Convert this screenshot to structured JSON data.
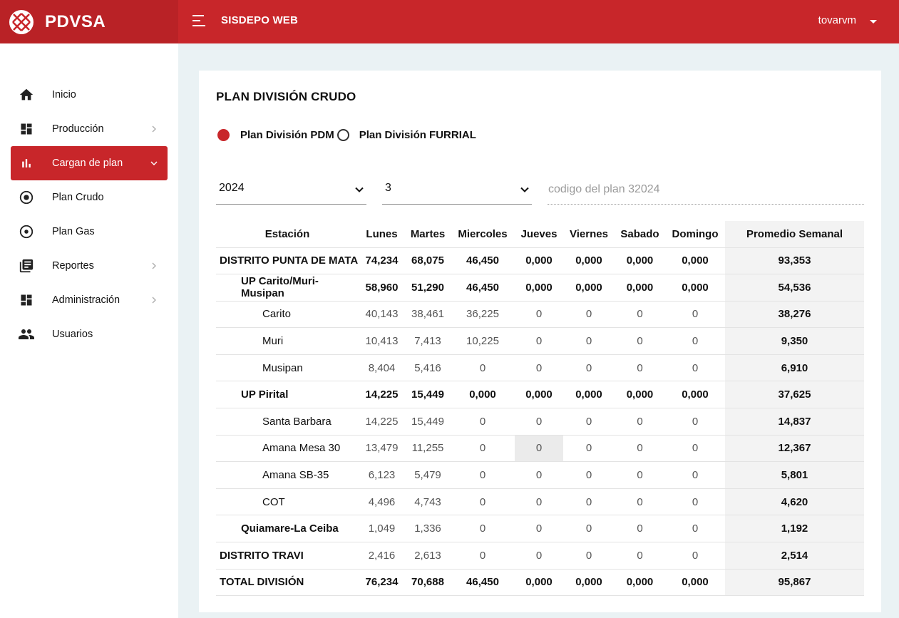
{
  "brand": {
    "name": "PDVSA"
  },
  "header": {
    "app_title": "SISDEPO WEB",
    "user": "tovarvm"
  },
  "sidebar": {
    "items": [
      {
        "label": "Inicio",
        "icon": "home-icon",
        "submenu": false,
        "active": false
      },
      {
        "label": "Producción",
        "icon": "dashboard-icon",
        "submenu": true,
        "active": false
      },
      {
        "label": "Cargan de plan",
        "icon": "bar-chart-icon",
        "submenu": true,
        "active": true
      },
      {
        "label": "Plan Crudo",
        "icon": "radio-target-icon",
        "submenu": false,
        "active": false
      },
      {
        "label": "Plan Gas",
        "icon": "radio-target-icon",
        "submenu": false,
        "active": false
      },
      {
        "label": "Reportes",
        "icon": "library-books-icon",
        "submenu": true,
        "active": false
      },
      {
        "label": "Administración",
        "icon": "dashboard-icon",
        "submenu": true,
        "active": false
      },
      {
        "label": "Usuarios",
        "icon": "people-icon",
        "submenu": false,
        "active": false
      }
    ]
  },
  "main": {
    "title": "PLAN DIVISIÓN CRUDO",
    "radio_pdm": "Plan División PDM",
    "radio_furrial": "Plan División FURRIAL",
    "selected_radio": "pdm",
    "year": "2024",
    "week": "3",
    "code_placeholder": "codigo del plan 32024",
    "columns": [
      "Estación",
      "Lunes",
      "Martes",
      "Miercoles",
      "Jueves",
      "Viernes",
      "Sabado",
      "Domingo",
      "Promedio Semanal"
    ],
    "rows": [
      {
        "name": "DISTRITO PUNTA DE MATA",
        "level": 0,
        "bold": true,
        "values": [
          "74,234",
          "68,075",
          "46,450",
          "0,000",
          "0,000",
          "0,000",
          "0,000"
        ],
        "avg": "93,353"
      },
      {
        "name": "UP Carito/Muri-Musipan",
        "level": 1,
        "bold": true,
        "values": [
          "58,960",
          "51,290",
          "46,450",
          "0,000",
          "0,000",
          "0,000",
          "0,000"
        ],
        "avg": "54,536"
      },
      {
        "name": "Carito",
        "level": 2,
        "bold": false,
        "values": [
          "40,143",
          "38,461",
          "36,225",
          "0",
          "0",
          "0",
          "0"
        ],
        "avg": "38,276"
      },
      {
        "name": "Muri",
        "level": 2,
        "bold": false,
        "values": [
          "10,413",
          "7,413",
          "10,225",
          "0",
          "0",
          "0",
          "0"
        ],
        "avg": "9,350"
      },
      {
        "name": "Musipan",
        "level": 2,
        "bold": false,
        "values": [
          "8,404",
          "5,416",
          "0",
          "0",
          "0",
          "0",
          "0"
        ],
        "avg": "6,910"
      },
      {
        "name": "UP Pirital",
        "level": 1,
        "bold": true,
        "values": [
          "14,225",
          "15,449",
          "0,000",
          "0,000",
          "0,000",
          "0,000",
          "0,000"
        ],
        "avg": "37,625"
      },
      {
        "name": "Santa Barbara",
        "level": 2,
        "bold": false,
        "values": [
          "14,225",
          "15,449",
          "0",
          "0",
          "0",
          "0",
          "0"
        ],
        "avg": "14,837"
      },
      {
        "name": "Amana Mesa 30",
        "level": 2,
        "bold": false,
        "values": [
          "13,479",
          "11,255",
          "0",
          "0",
          "0",
          "0",
          "0"
        ],
        "avg": "12,367",
        "highlight_col": 3
      },
      {
        "name": "Amana SB-35",
        "level": 2,
        "bold": false,
        "values": [
          "6,123",
          "5,479",
          "0",
          "0",
          "0",
          "0",
          "0"
        ],
        "avg": "5,801"
      },
      {
        "name": "COT",
        "level": 2,
        "bold": false,
        "values": [
          "4,496",
          "4,743",
          "0",
          "0",
          "0",
          "0",
          "0"
        ],
        "avg": "4,620"
      },
      {
        "name": "Quiamare-La Ceiba",
        "level": 1,
        "bold": false,
        "name_bold": true,
        "values": [
          "1,049",
          "1,336",
          "0",
          "0",
          "0",
          "0",
          "0"
        ],
        "avg": "1,192"
      },
      {
        "name": "DISTRITO TRAVI",
        "level": 0,
        "bold": false,
        "name_bold": true,
        "values": [
          "2,416",
          "2,613",
          "0",
          "0",
          "0",
          "0",
          "0"
        ],
        "avg": "2,514"
      },
      {
        "name": "TOTAL DIVISIÓN",
        "level": 0,
        "bold": true,
        "values": [
          "76,234",
          "70,688",
          "46,450",
          "0,000",
          "0,000",
          "0,000",
          "0,000"
        ],
        "avg": "95,867"
      }
    ]
  },
  "colors": {
    "brand_red": "#c8262a",
    "brand_red_dark": "#b92226",
    "page_bg": "#eaf2f4"
  }
}
